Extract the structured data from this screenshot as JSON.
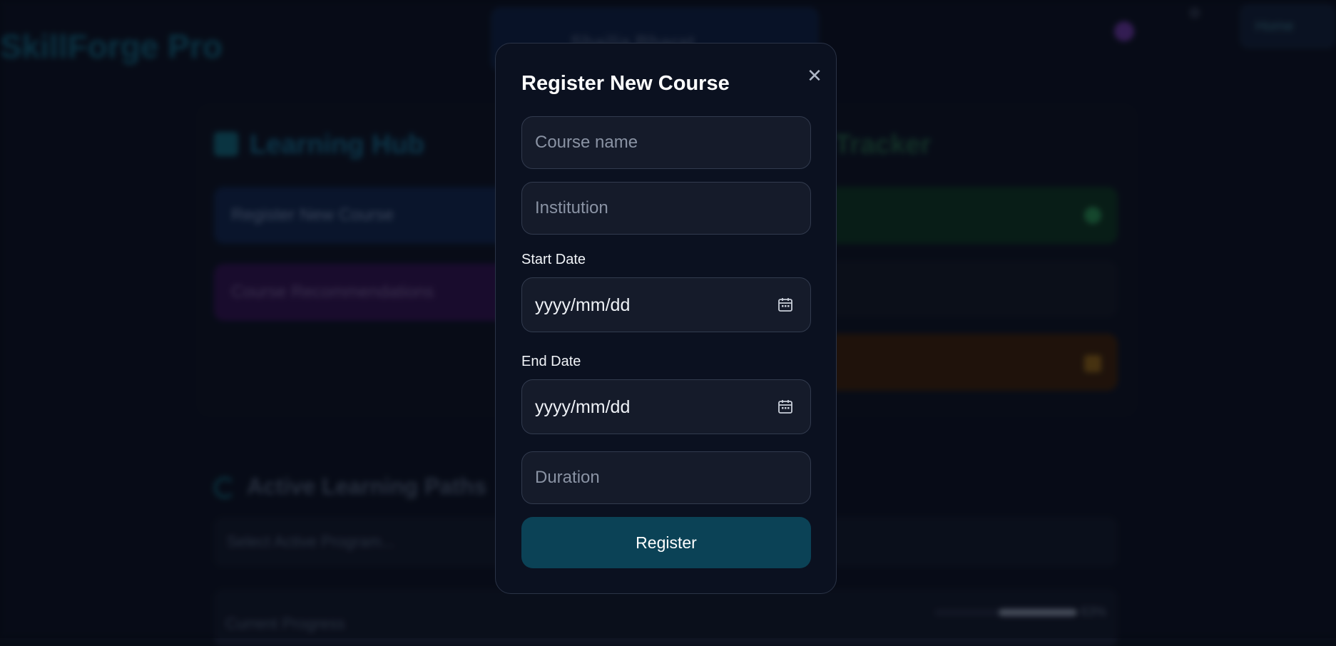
{
  "background": {
    "brand": "SkillForge Pro",
    "profile_name": "Shailja Bharat",
    "home_label": "Home",
    "hub_title": "Learning Hub",
    "tracker_title": "Tracker",
    "cards": {
      "register": "Register New Course",
      "recommendations": "Course Recommendations"
    },
    "active_title": "Active Learning Paths",
    "select_placeholder": "Select Active Program...",
    "progress_label": "Current Progress",
    "progress_value": "63%",
    "progress_fraction": 0.63
  },
  "modal": {
    "title": "Register New Course",
    "close_icon": "close-icon",
    "course_name_placeholder": "Course name",
    "institution_placeholder": "Institution",
    "start_date_label": "Start Date",
    "start_date_value": "yyyy/mm/dd",
    "end_date_label": "End Date",
    "end_date_value": "yyyy/mm/dd",
    "duration_placeholder": "Duration",
    "register_label": "Register",
    "calendar_icon": "calendar-icon"
  },
  "colors": {
    "modal_bg": "#0b1120",
    "field_bg": "#151b2a",
    "button_bg": "#0b4256",
    "text": "#ffffff"
  }
}
